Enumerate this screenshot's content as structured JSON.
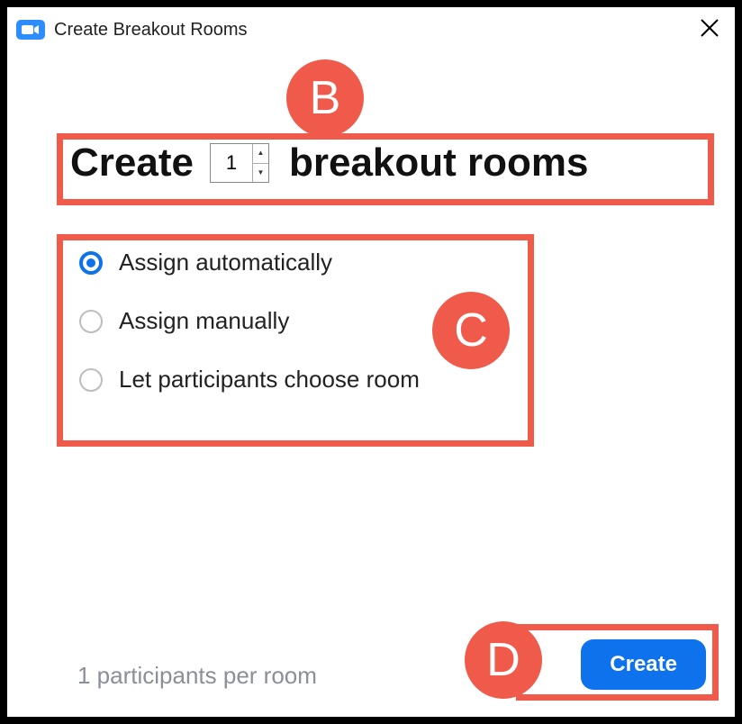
{
  "window": {
    "title": "Create Breakout Rooms"
  },
  "annotations": {
    "b": "B",
    "c": "C",
    "d": "D",
    "highlight_color": "#f05a4b"
  },
  "headline": {
    "before": "Create",
    "after": "breakout rooms",
    "room_count": "1"
  },
  "options": [
    {
      "label": "Assign automatically",
      "selected": true
    },
    {
      "label": "Assign manually",
      "selected": false
    },
    {
      "label": "Let participants choose room",
      "selected": false
    }
  ],
  "footer": {
    "info": "1 participants per room",
    "create_label": "Create"
  },
  "colors": {
    "primary": "#0e72ed",
    "zoom_blue": "#2d8cff"
  }
}
